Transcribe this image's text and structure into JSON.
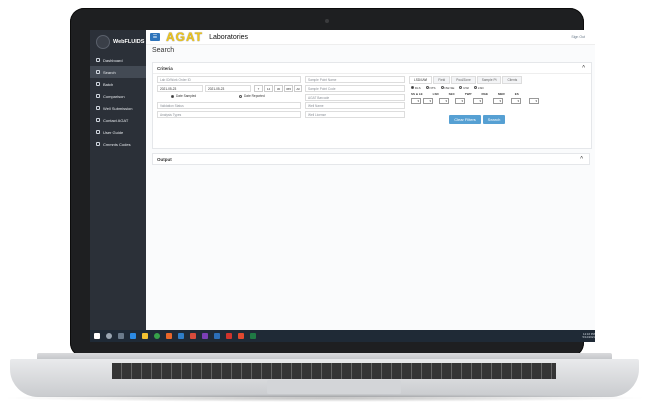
{
  "app": {
    "title": "WebFLUIDS",
    "logo_text": "AGAT",
    "lab_text": "Laboratories",
    "signout": "Sign Out"
  },
  "sidebar": {
    "items": [
      {
        "label": "Dashboard",
        "icon": "home-icon"
      },
      {
        "label": "Search",
        "icon": "search-icon"
      },
      {
        "label": "Batch",
        "icon": "list-icon"
      },
      {
        "label": "Comparison",
        "icon": "chart-icon"
      },
      {
        "label": "Well Submission",
        "icon": "upload-icon"
      },
      {
        "label": "Contact AGAT",
        "icon": "mail-icon"
      },
      {
        "label": "User Guide",
        "icon": "info-icon"
      },
      {
        "label": "Cmmnts Codes",
        "icon": "file-icon"
      }
    ]
  },
  "page": {
    "title": "Search"
  },
  "criteria": {
    "title": "Criteria",
    "lab_id_placeholder": "Lab ID/Work Order ID",
    "date_from": "2021-05-23",
    "date_to": "2021-05-23",
    "range_buttons": [
      "7",
      "14",
      "30",
      "365",
      "All"
    ],
    "date_sampled": "Date Sampled",
    "date_reported": "Date Reported",
    "validation_status": "Validation Status",
    "analysis_types": "Analysis Types",
    "sample_point_name": "Sample Point Name",
    "sample_point_code": "Sample Point Code",
    "agat_barcode": "AGAT Barcode",
    "well_name": "Well Name",
    "well_license": "Well License"
  },
  "tabs": [
    "LSD/UWI",
    "Field",
    "Pool/Zone",
    "Sample Pt",
    "Clients"
  ],
  "lsd": {
    "radios": [
      "DLS",
      "NTS",
      "NW-SE",
      "UWI",
      "LSD"
    ],
    "columns": [
      "SS & LE",
      "LSD",
      "SEC",
      "TWP",
      "RGE",
      "MER",
      "ES"
    ]
  },
  "buttons": {
    "clear_filters": "Clear Filters",
    "search": "Search"
  },
  "output": {
    "title": "Output"
  },
  "taskbar": {
    "time": "12:16 PM",
    "date": "5/14/2021"
  },
  "colors": {
    "sidebar_bg": "#2b3038",
    "accent_blue": "#56a0d3",
    "agat_yellow": "#efc619"
  }
}
